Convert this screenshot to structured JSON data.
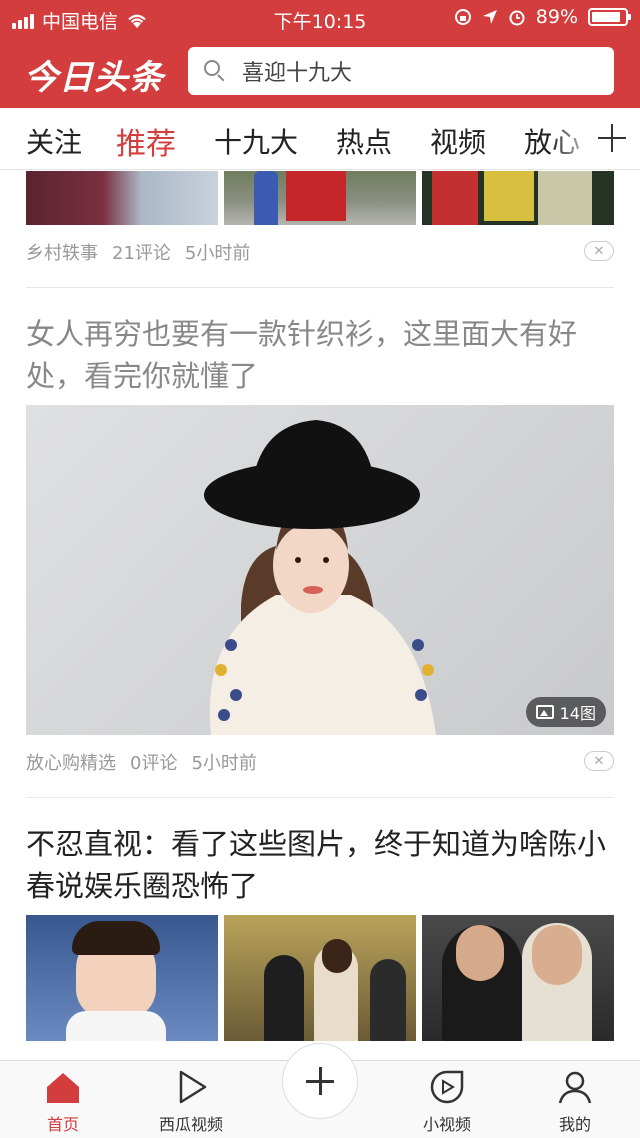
{
  "status_bar": {
    "carrier": "中国电信",
    "time": "下午10:15",
    "battery": "89%",
    "battery_level": 0.89
  },
  "header": {
    "logo": "今日头条",
    "search_placeholder": "喜迎十九大"
  },
  "tabs": [
    "关注",
    "推荐",
    "十九大",
    "热点",
    "视频",
    "放心"
  ],
  "active_tab": "推荐",
  "feed": [
    {
      "source": "乡村轶事",
      "comments": "21评论",
      "time": "5小时前"
    },
    {
      "title": "女人再穷也要有一款针织衫，这里面大有好处，看完你就懂了",
      "image_count": "14图",
      "source": "放心购精选",
      "comments": "0评论",
      "time": "5小时前"
    },
    {
      "title": "不忍直视：看了这些图片，终于知道为啥陈小春说娱乐圈恐怖了"
    }
  ],
  "bottom_nav": {
    "home": "首页",
    "xigua": "西瓜视频",
    "mini_video": "小视频",
    "me": "我的"
  },
  "colors": {
    "brand": "#d43d3d",
    "text": "#222222",
    "meta": "#999999"
  }
}
